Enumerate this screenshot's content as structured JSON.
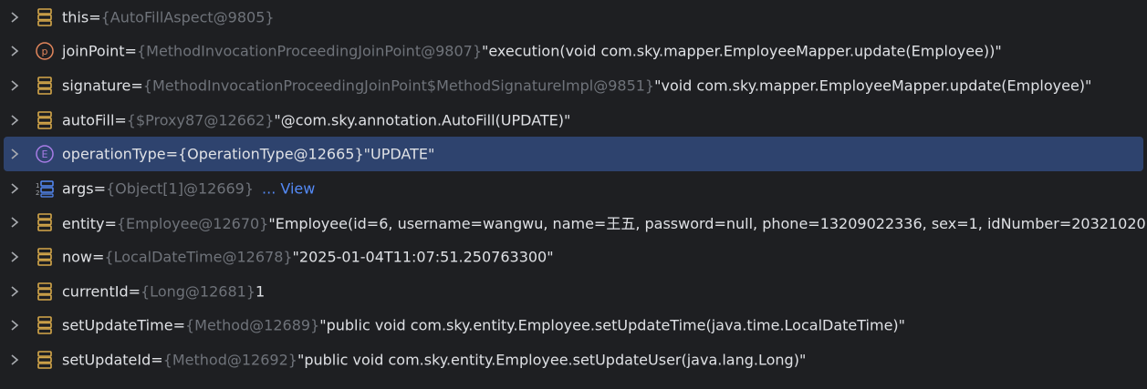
{
  "rows": [
    {
      "name": "this",
      "eq": " = ",
      "type": "{AutoFillAspect@9805}",
      "value": "",
      "link": ""
    },
    {
      "name": "joinPoint",
      "eq": " = ",
      "type": "{MethodInvocationProceedingJoinPoint@9807}",
      "value": " \"execution(void com.sky.mapper.EmployeeMapper.update(Employee))\"",
      "link": ""
    },
    {
      "name": "signature",
      "eq": " = ",
      "type": "{MethodInvocationProceedingJoinPoint$MethodSignatureImpl@9851}",
      "value": " \"void com.sky.mapper.EmployeeMapper.update(Employee)\"",
      "link": ""
    },
    {
      "name": "autoFill",
      "eq": " = ",
      "type": "{$Proxy87@12662}",
      "value": " \"@com.sky.annotation.AutoFill(UPDATE)\"",
      "link": ""
    },
    {
      "name": "operationType",
      "eq": " = ",
      "type": "{OperationType@12665}",
      "value": " \"UPDATE\"",
      "link": ""
    },
    {
      "name": "args",
      "eq": " = ",
      "type": "{Object[1]@12669}",
      "value": "",
      "link": "... View"
    },
    {
      "name": "entity",
      "eq": " = ",
      "type": "{Employee@12670}",
      "value": " \"Employee(id=6, username=wangwu, name=王五, password=null, phone=13209022336, sex=1, idNumber=20321020",
      "link": ""
    },
    {
      "name": "now",
      "eq": " = ",
      "type": "{LocalDateTime@12678}",
      "value": " \"2025-01-04T11:07:51.250763300\"",
      "link": ""
    },
    {
      "name": "currentId",
      "eq": " = ",
      "type": "{Long@12681}",
      "value": " 1",
      "link": ""
    },
    {
      "name": "setUpdateTime",
      "eq": " = ",
      "type": "{Method@12689}",
      "value": " \"public void com.sky.entity.Employee.setUpdateTime(java.time.LocalDateTime)\"",
      "link": ""
    },
    {
      "name": "setUpdateId",
      "eq": " = ",
      "type": "{Method@12692}",
      "value": " \"public void com.sky.entity.Employee.setUpdateUser(java.lang.Long)\"",
      "link": ""
    }
  ],
  "icons": {
    "field": "field-icon",
    "parameter": "parameter-p-icon",
    "enum": "enum-e-icon",
    "array": "array-icon",
    "chevron": "chevron-right-icon"
  },
  "colors": {
    "background": "#1e1f22",
    "selection": "#2e436e",
    "name": "#c77dbb",
    "type": "#6f737a",
    "value": "#dfe1e5",
    "link": "#548af7",
    "field_icon": "#d5a74a",
    "param_icon": "#e2865c",
    "enum_icon": "#a77ce6",
    "array_icon": "#548af7"
  }
}
